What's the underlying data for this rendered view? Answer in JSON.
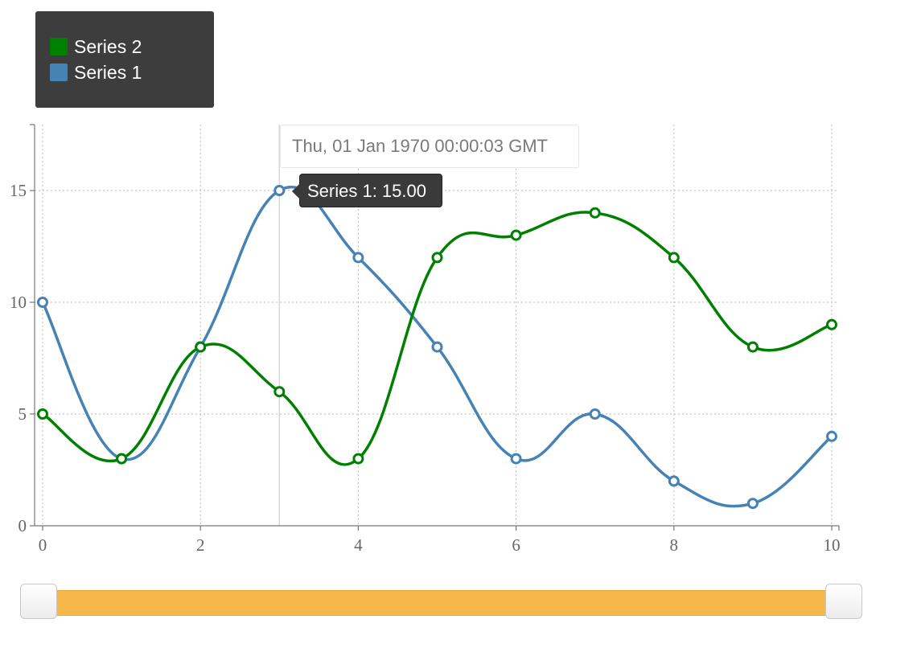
{
  "legend": {
    "items": [
      {
        "label": "Series 2",
        "color": "#008000"
      },
      {
        "label": "Series 1",
        "color": "#4682b4"
      }
    ]
  },
  "tooltip": {
    "time_label": "Thu, 01 Jan 1970 00:00:03 GMT",
    "value_label": "Series 1: 15.00",
    "hover_x": 3
  },
  "chart_data": {
    "type": "line",
    "title": "",
    "xlabel": "",
    "ylabel": "",
    "x": [
      0,
      1,
      2,
      3,
      4,
      5,
      6,
      7,
      8,
      9,
      10
    ],
    "xlim": [
      0,
      10
    ],
    "ylim": [
      0,
      18
    ],
    "x_ticks": [
      0,
      2,
      4,
      6,
      8,
      10
    ],
    "y_ticks": [
      0,
      5,
      10,
      15
    ],
    "grid": true,
    "legend_position": "top-left",
    "series": [
      {
        "name": "Series 1",
        "color": "#4682b4",
        "values": [
          10,
          3,
          8,
          15,
          12,
          8,
          3,
          5,
          2,
          1,
          4
        ]
      },
      {
        "name": "Series 2",
        "color": "#008000",
        "values": [
          5,
          3,
          8,
          6,
          3,
          12,
          13,
          14,
          12,
          8,
          9
        ]
      }
    ]
  },
  "range_slider": {
    "start": 0,
    "end": 10,
    "fill_color": "#f7b84b"
  }
}
